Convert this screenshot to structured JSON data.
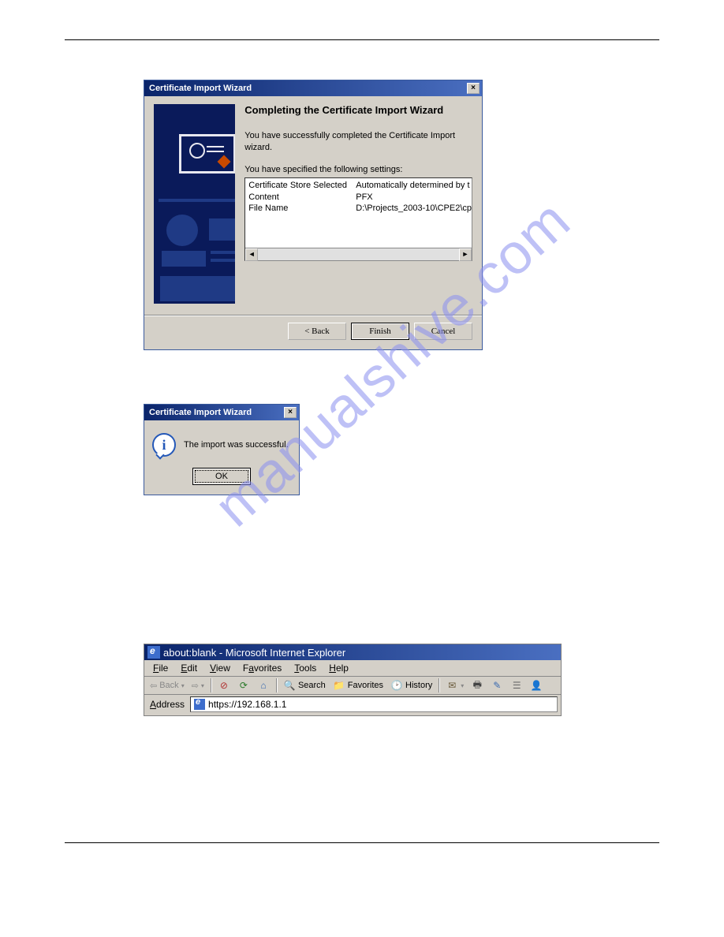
{
  "watermark": "manualshive.com",
  "wizard": {
    "title": "Certificate Import Wizard",
    "heading": "Completing the Certificate Import Wizard",
    "success_line": "You have successfully completed the Certificate Import wizard.",
    "specified_line": "You have specified the following settings:",
    "settings": {
      "rows": [
        {
          "label": "Certificate Store Selected",
          "value": "Automatically determined by t"
        },
        {
          "label": "Content",
          "value": "PFX"
        },
        {
          "label": "File Name",
          "value": "D:\\Projects_2003-10\\CPE2\\cp"
        }
      ]
    },
    "buttons": {
      "back": "< Back",
      "finish": "Finish",
      "cancel": "Cancel"
    },
    "close_glyph": "×"
  },
  "success_dialog": {
    "title": "Certificate Import Wizard",
    "message": "The import was successful.",
    "ok": "OK",
    "close_glyph": "×"
  },
  "ie": {
    "title": "about:blank - Microsoft Internet Explorer",
    "menus": [
      "File",
      "Edit",
      "View",
      "Favorites",
      "Tools",
      "Help"
    ],
    "toolbar": {
      "back": "Back",
      "search": "Search",
      "favorites": "Favorites",
      "history": "History"
    },
    "address_label": "Address",
    "address_value": "https://192.168.1.1"
  }
}
